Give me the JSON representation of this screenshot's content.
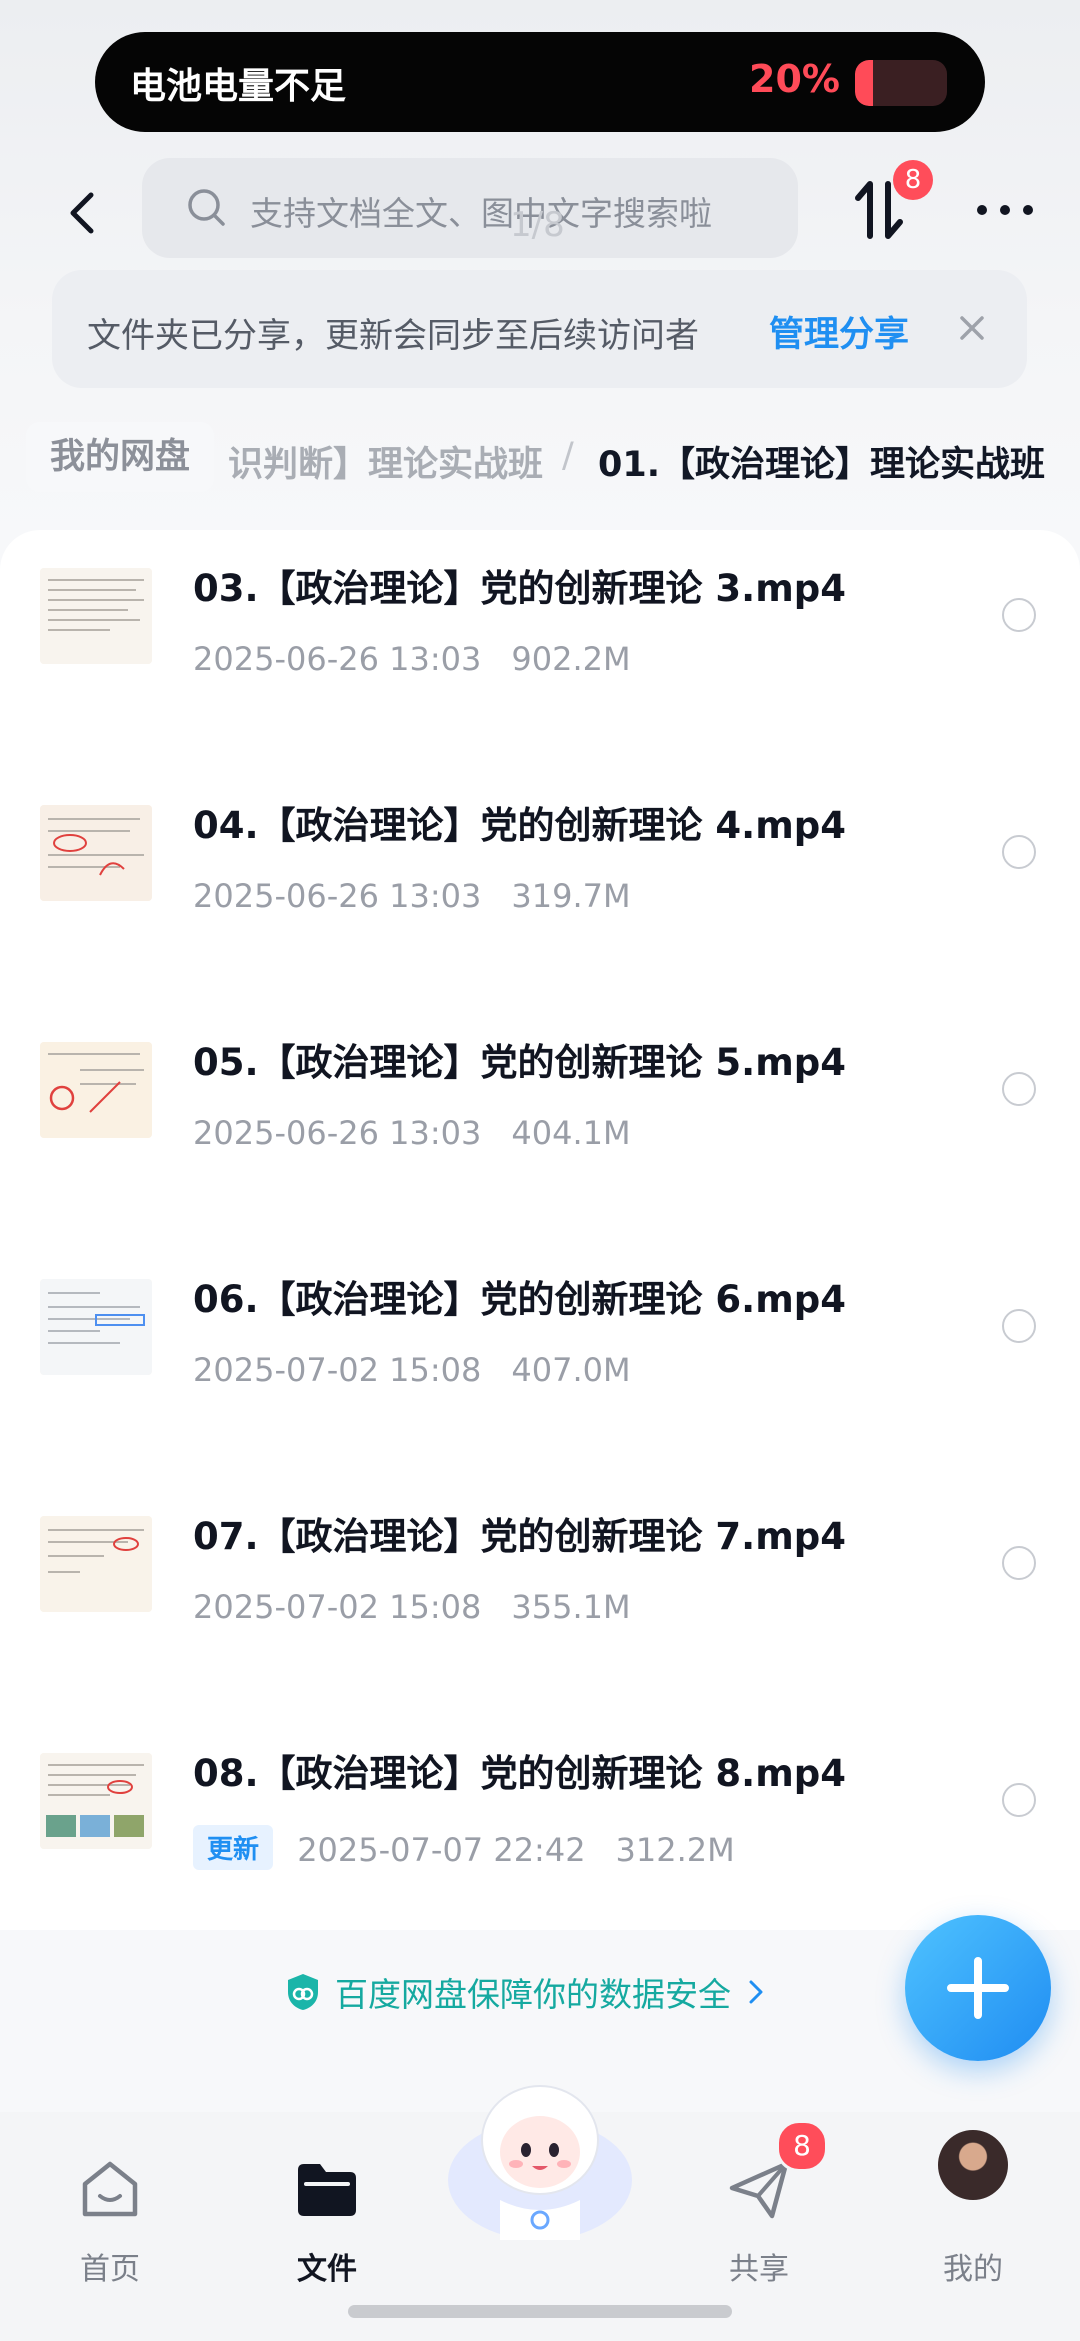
{
  "status": {
    "battery_warning": "电池电量不足",
    "battery_percent": "20%",
    "battery_level": 0.2,
    "battery_color": "#ff4b58"
  },
  "header": {
    "search_placeholder": "支持文档全文、图中文字搜索啦",
    "search_ghost": "1/8",
    "transfer_badge": "8"
  },
  "banner": {
    "text": "文件夹已分享，更新会同步至后续访问者",
    "link": "管理分享"
  },
  "breadcrumb": {
    "home": "我的网盘",
    "middle": "识判断】理论实战班",
    "separator": "/",
    "current": "01.【政治理论】理论实战班"
  },
  "files": [
    {
      "name": "03.【政治理论】党的创新理论 3.mp4",
      "date": "2025-06-26 13:03",
      "size": "902.2M",
      "tag": ""
    },
    {
      "name": "04.【政治理论】党的创新理论 4.mp4",
      "date": "2025-06-26 13:03",
      "size": "319.7M",
      "tag": ""
    },
    {
      "name": "05.【政治理论】党的创新理论 5.mp4",
      "date": "2025-06-26 13:03",
      "size": "404.1M",
      "tag": ""
    },
    {
      "name": "06.【政治理论】党的创新理论 6.mp4",
      "date": "2025-07-02 15:08",
      "size": "407.0M",
      "tag": ""
    },
    {
      "name": "07.【政治理论】党的创新理论 7.mp4",
      "date": "2025-07-02 15:08",
      "size": "355.1M",
      "tag": ""
    },
    {
      "name": "08.【政治理论】党的创新理论 8.mp4",
      "date": "2025-07-07 22:42",
      "size": "312.2M",
      "tag": "更新"
    }
  ],
  "safety": {
    "text": "百度网盘保障你的数据安全"
  },
  "nav": {
    "home": "首页",
    "files": "文件",
    "share": "共享",
    "share_badge": "8",
    "me": "我的"
  },
  "colors": {
    "accent": "#1f8ff2",
    "badge": "#ff4d5a",
    "safety": "#15a9a0"
  }
}
